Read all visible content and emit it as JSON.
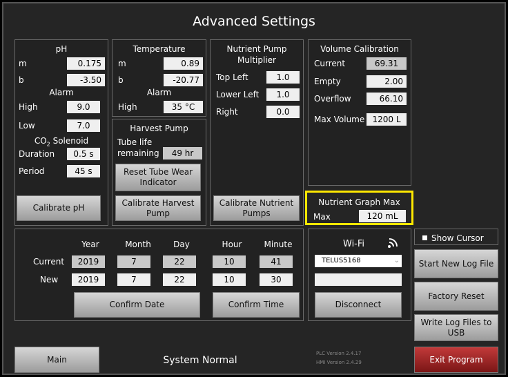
{
  "title": "Advanced Settings",
  "ph": {
    "header": "pH",
    "m_label": "m",
    "m_value": "0.175",
    "b_label": "b",
    "b_value": "-3.50",
    "alarm_label": "Alarm",
    "high_label": "High",
    "high_value": "9.0",
    "low_label": "Low",
    "low_value": "7.0",
    "co2_label_main": "CO",
    "co2_label_sub": "2",
    "co2_label_rest": " Solenoid",
    "duration_label": "Duration",
    "duration_value": "0.5 s",
    "period_label": "Period",
    "period_value": "45 s",
    "calibrate_button": "Calibrate pH"
  },
  "temperature": {
    "header": "Temperature",
    "m_label": "m",
    "m_value": "0.89",
    "b_label": "b",
    "b_value": "-20.77",
    "alarm_label": "Alarm",
    "high_label": "High",
    "high_value": "35 °C"
  },
  "harvest": {
    "header": "Harvest Pump",
    "tube_life_label": "Tube life",
    "remaining_label": "remaining",
    "remaining_value": "49 hr",
    "reset_button": "Reset Tube Wear Indicator",
    "calibrate_button": "Calibrate Harvest Pump"
  },
  "nutrient_pump": {
    "header": "Nutrient Pump Multiplier",
    "top_left_label": "Top Left",
    "top_left_value": "1.0",
    "lower_left_label": "Lower Left",
    "lower_left_value": "1.0",
    "right_label": "Right",
    "right_value": "0.0",
    "calibrate_button": "Calibrate Nutrient Pumps"
  },
  "volume": {
    "header": "Volume Calibration",
    "current_label": "Current",
    "current_value": "69.31",
    "empty_label": "Empty",
    "empty_value": "2.00",
    "overflow_label": "Overflow",
    "overflow_value": "66.10",
    "max_volume_label": "Max Volume",
    "max_volume_value": "1200 L"
  },
  "nutrient_graph": {
    "header": "Nutrient Graph Max",
    "max_label": "Max",
    "max_value": "120 mL",
    "highlight_color": "#ffe800"
  },
  "datetime": {
    "year_label": "Year",
    "month_label": "Month",
    "day_label": "Day",
    "hour_label": "Hour",
    "minute_label": "Minute",
    "current_label": "Current",
    "new_label": "New",
    "current": {
      "year": "2019",
      "month": "7",
      "day": "22",
      "hour": "10",
      "minute": "41"
    },
    "new": {
      "year": "2019",
      "month": "7",
      "day": "22",
      "hour": "10",
      "minute": "30"
    },
    "confirm_date_button": "Confirm Date",
    "confirm_time_button": "Confirm Time"
  },
  "wifi": {
    "header": "Wi-Fi",
    "network_selected": "TELUS5168",
    "password_value": "",
    "disconnect_button": "Disconnect",
    "icon": "wifi-icon"
  },
  "right_buttons": {
    "show_cursor_label": "Show Cursor",
    "start_log_button": "Start New Log File",
    "factory_reset_button": "Factory Reset",
    "write_log_button": "Write Log Files to USB"
  },
  "footer": {
    "main_button": "Main",
    "status": "System Normal",
    "plc_version": "PLC Version 2.4.17",
    "hmi_version": "HMI Version 2.4.29",
    "exit_button": "Exit Program"
  }
}
